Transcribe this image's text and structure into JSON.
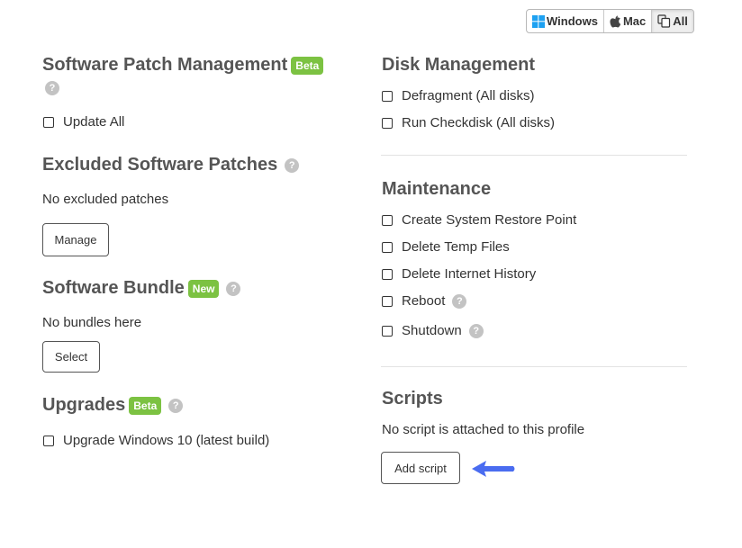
{
  "os_toggle": {
    "windows_label": "Windows",
    "mac_label": "Mac",
    "all_label": "All",
    "selected": "All"
  },
  "software_patch": {
    "title": "Software Patch Management",
    "badge": "Beta",
    "help_icon": "?",
    "update_all_label": "Update All"
  },
  "excluded_patches": {
    "title": "Excluded Software Patches",
    "help_icon": "?",
    "empty_text": "No excluded patches",
    "manage_button": "Manage"
  },
  "software_bundle": {
    "title": "Software Bundle",
    "badge": "New",
    "help_icon": "?",
    "empty_text": "No bundles here",
    "select_button": "Select"
  },
  "upgrades": {
    "title": "Upgrades",
    "badge": "Beta",
    "help_icon": "?",
    "upgrade_label": "Upgrade Windows 10 (latest build)"
  },
  "disk_management": {
    "title": "Disk Management",
    "items": [
      "Defragment (All disks)",
      "Run Checkdisk (All disks)"
    ]
  },
  "maintenance": {
    "title": "Maintenance",
    "items": [
      "Create System Restore Point",
      "Delete Temp Files",
      "Delete Internet History",
      "Reboot",
      "Shutdown"
    ],
    "help_icon": "?"
  },
  "scripts": {
    "title": "Scripts",
    "empty_text": "No script is attached to this profile",
    "add_button": "Add script"
  },
  "colors": {
    "badge_green": "#7cc242",
    "heading": "#555555",
    "help_grey": "#c3c3c3",
    "arrow_blue": "#4a6cf0"
  }
}
